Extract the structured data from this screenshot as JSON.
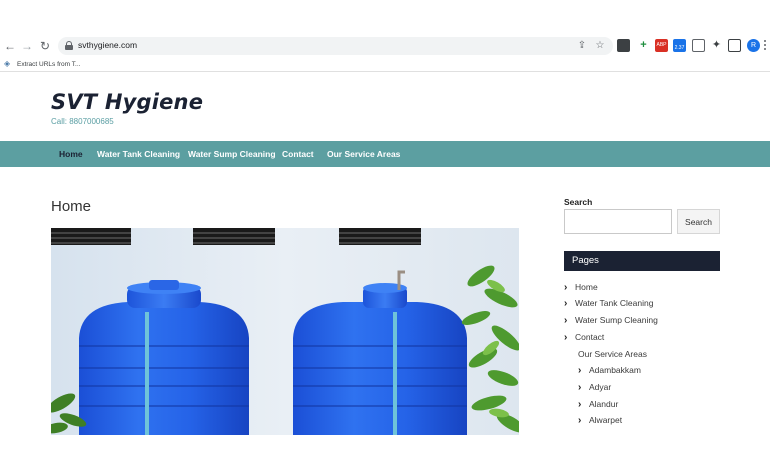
{
  "browser": {
    "url": "svthygiene.com",
    "bookmark_label": "Extract URLs from T...",
    "profile_initial": "R",
    "extension_badge": "2.37",
    "adblock_label": "ABP"
  },
  "site": {
    "title": "SVT Hygiene",
    "phone": "Call: 8807000685"
  },
  "nav": {
    "items": [
      "Home",
      "Water Tank Cleaning",
      "Water Sump Cleaning",
      "Contact",
      "Our Service Areas"
    ]
  },
  "main": {
    "page_title": "Home"
  },
  "sidebar": {
    "search_label": "Search",
    "search_button": "Search",
    "search_value": "",
    "pages_heading": "Pages",
    "pages": [
      "Home",
      "Water Tank Cleaning",
      "Water Sump Cleaning",
      "Contact",
      "Our Service Areas",
      "Adambakkam",
      "Adyar",
      "Alandur",
      "Alwarpet"
    ]
  }
}
